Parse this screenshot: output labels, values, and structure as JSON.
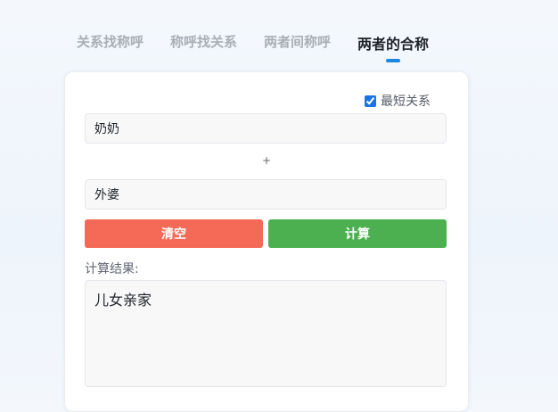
{
  "tabs": [
    {
      "label": "关系找称呼",
      "active": false
    },
    {
      "label": "称呼找关系",
      "active": false
    },
    {
      "label": "两者间称呼",
      "active": false
    },
    {
      "label": "两者的合称",
      "active": true
    }
  ],
  "options": {
    "shortest_label": "最短关系",
    "shortest_checked": true
  },
  "inputs": {
    "first_value": "奶奶",
    "operator": "+",
    "second_value": "外婆"
  },
  "buttons": {
    "clear_label": "清空",
    "calc_label": "计算"
  },
  "result": {
    "label": "计算结果:",
    "value": "儿女亲家"
  },
  "colors": {
    "accent": "#1e88e5",
    "clear_button": "#f46a56",
    "calc_button": "#4caf50"
  }
}
